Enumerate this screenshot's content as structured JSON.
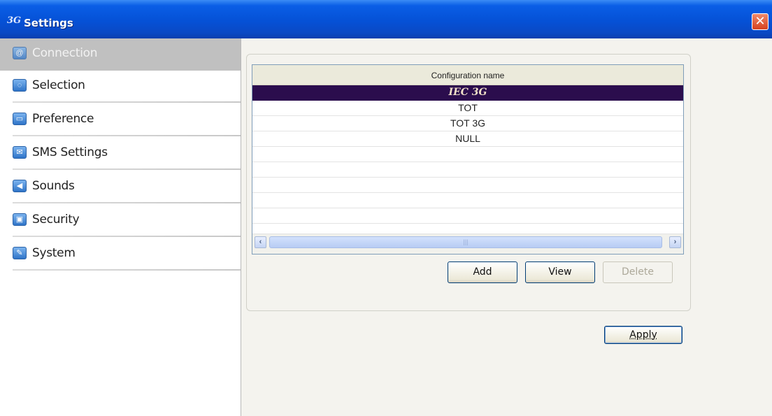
{
  "window": {
    "title": "Settings",
    "app_icon_text": "3G"
  },
  "sidebar": {
    "items": [
      {
        "label": "Connection",
        "icon": "connection-icon",
        "active": true
      },
      {
        "label": "Selection",
        "icon": "selection-icon"
      },
      {
        "label": "Preference",
        "icon": "preference-icon"
      },
      {
        "label": "SMS Settings",
        "icon": "sms-icon"
      },
      {
        "label": "Sounds",
        "icon": "sounds-icon"
      },
      {
        "label": "Security",
        "icon": "security-icon"
      },
      {
        "label": "System",
        "icon": "system-icon"
      }
    ]
  },
  "config_list": {
    "header": "Configuration name",
    "rows": [
      "IEC 3G",
      "TOT",
      "TOT 3G",
      "NULL"
    ],
    "selected_index": 0
  },
  "buttons": {
    "add": "Add",
    "view": "View",
    "delete": "Delete",
    "apply": "Apply"
  },
  "colors": {
    "titlebar": "#0551d6",
    "selection": "#2b0d4d",
    "sidebar_active": "#c0c0c0"
  }
}
